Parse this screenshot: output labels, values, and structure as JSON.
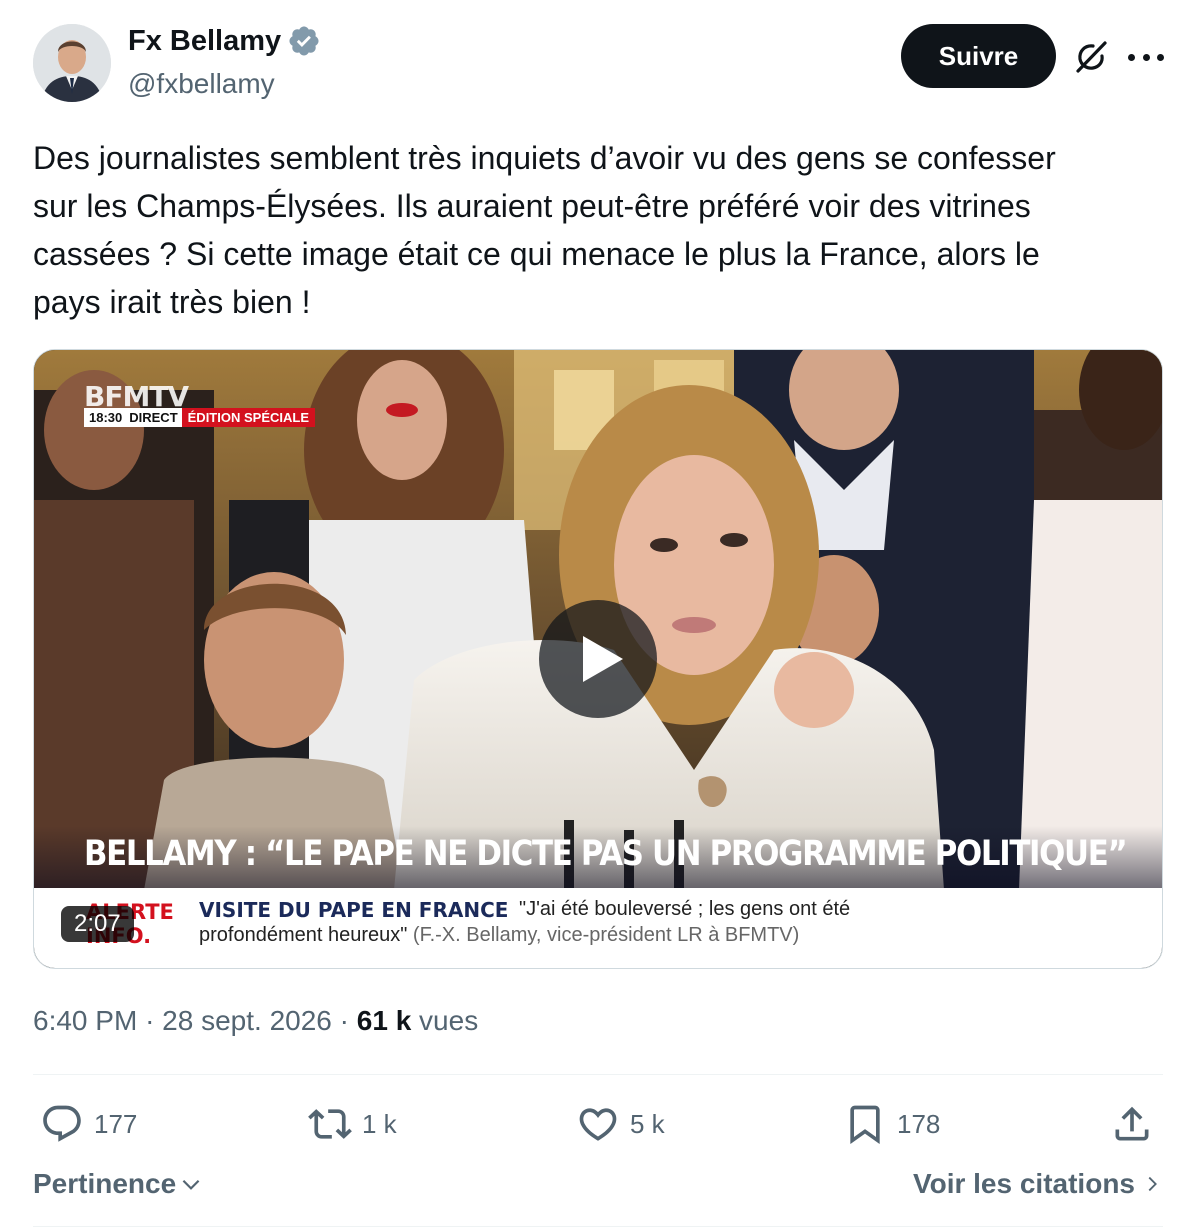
{
  "author": {
    "name": "Fx Bellamy",
    "handle": "@fxbellamy",
    "verified_color": "#829aab"
  },
  "header": {
    "follow_label": "Suivre"
  },
  "tweet": {
    "text": "Des journalistes semblent très inquiets d’avoir vu des gens se confesser\nsur les Champs-Élysées. Ils auraient peut-être préféré voir des vitrines\ncassées ? Si cette image était ce qui menace le plus la France, alors le\npays irait très bien !"
  },
  "video": {
    "channel_logo": "BFMTV",
    "bar_time": "18:30",
    "bar_direct": "DIRECT",
    "bar_edition": "ÉDITION SPÉCIALE",
    "headline": "BELLAMY : “LE PAPE NE DICTE PAS UN PROGRAMME POLITIQUE”",
    "ticker_red": "ALERTE INFO.",
    "ticker_title": "VISITE DU PAPE EN FRANCE",
    "ticker_quote": "\"J'ai été bouleversé ; les gens ont été",
    "ticker_line2": "profondément heureux\"",
    "ticker_attrib": "(F.-X. Bellamy, vice-président LR à BFMTV)",
    "duration": "2:07",
    "brand_red": "#d3111e"
  },
  "meta": {
    "time": "6:40 PM",
    "separator": "·",
    "date": "28 sept. 2026",
    "views_count": "61 k",
    "views_label": "vues"
  },
  "actions": {
    "replies": "177",
    "reposts": "1 k",
    "likes": "5 k",
    "bookmarks": "178"
  },
  "footer": {
    "sort_label": "Pertinence",
    "quotes_label": "Voir les citations"
  }
}
